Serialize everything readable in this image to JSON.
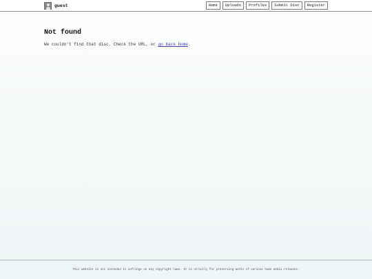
{
  "header": {
    "username": "guest",
    "avatar_icon": "user-avatar-icon",
    "nav": [
      {
        "label": "Home"
      },
      {
        "label": "Uploads"
      },
      {
        "label": "Profiles"
      },
      {
        "label": "Submit Disc"
      },
      {
        "label": "Register"
      }
    ]
  },
  "main": {
    "title": "Not found",
    "message_prefix": "We couldn’t find that disc. Check the URL, or ",
    "link_text": "go back home",
    "message_suffix": "."
  },
  "footer": {
    "text": "This website is not intended to infringe on any copyright laws. It is strictly for preserving works of various home media releases."
  },
  "colors": {
    "link": "#3a3ab0",
    "border": "#7a7a7a"
  }
}
